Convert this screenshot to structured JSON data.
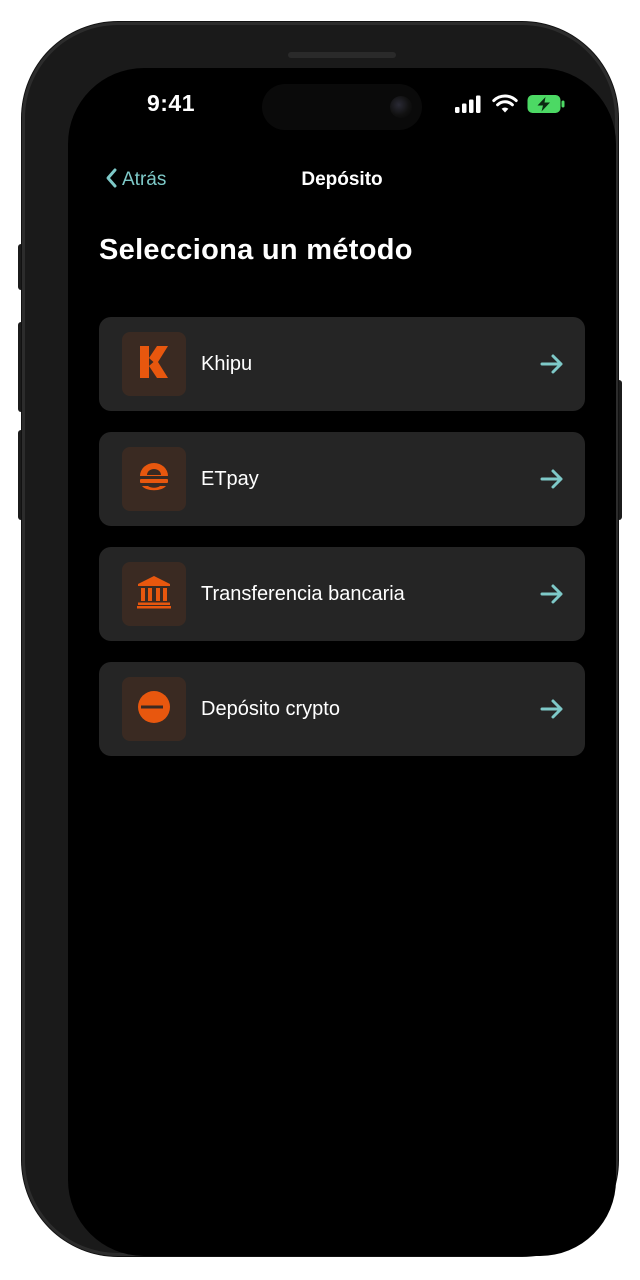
{
  "status_bar": {
    "time": "9:41",
    "signal_icon": "cellular-signal-icon",
    "wifi_icon": "wifi-icon",
    "battery_icon": "battery-charging-icon",
    "battery_color": "#4cd964"
  },
  "nav": {
    "back_label": "Atrás",
    "back_icon": "chevron-left-icon",
    "title": "Depósito"
  },
  "page": {
    "heading": "Selecciona un método"
  },
  "methods": [
    {
      "label": "Khipu",
      "icon": "khipu-logo-icon"
    },
    {
      "label": "ETpay",
      "icon": "etpay-logo-icon"
    },
    {
      "label": "Transferencia bancaria",
      "icon": "bank-icon"
    },
    {
      "label": "Depósito crypto",
      "icon": "crypto-icon"
    }
  ],
  "colors": {
    "accent_orange": "#e8570e",
    "accent_teal": "#7ec9c8",
    "card_background": "#252525",
    "icon_tile_background": "#3a2a22",
    "screen_background": "#000000"
  }
}
